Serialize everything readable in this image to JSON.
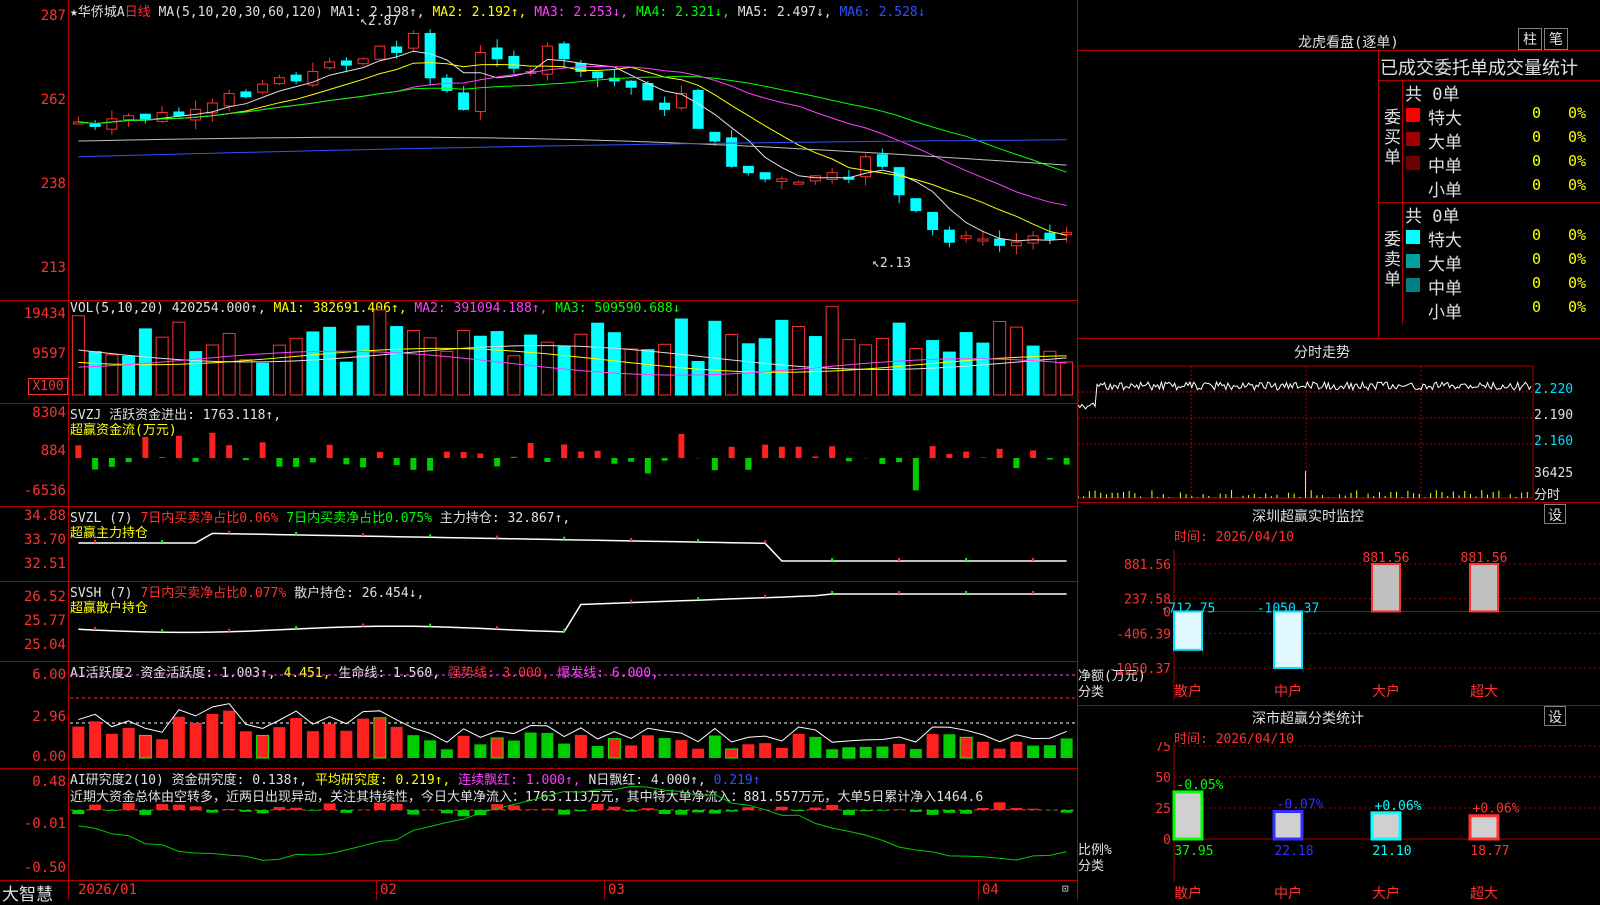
{
  "header": {
    "star": "★",
    "name": "华侨城A",
    "period": "日线",
    "ma_label": "MA(5,10,20,30,60,120)",
    "ma1": "MA1: 2.198↑,",
    "ma2": "MA2: 2.192↑,",
    "ma3": "MA3: 2.253↓,",
    "ma4": "MA4: 2.321↓,",
    "ma5": "MA5: 2.497↓,",
    "ma6": "MA6: 2.528↓",
    "high_mark": "2.87",
    "low_mark": "2.13"
  },
  "price_axis": [
    "287",
    "262",
    "238",
    "213"
  ],
  "vol": {
    "label": "VOL(5,10,20)",
    "value": "420254.000↑,",
    "ma1": "MA1: 382691.406↑,",
    "ma2": "MA2: 391094.188↑,",
    "ma3": "MA3: 509590.688↓",
    "axis": [
      "19434",
      "9597",
      "X100"
    ]
  },
  "svzj": {
    "label": "SVZJ  活跃资金进出: 1763.118↑,",
    "sub": "超赢资金流(万元)",
    "axis": [
      "8304",
      "884",
      "-6536"
    ]
  },
  "svzl": {
    "label1": "SVZL (7)",
    "label2": "7日内买卖净占比0.06%",
    "label3": "7日内买卖净占比0.075%",
    "label4": "主力持仓: 32.867↑,",
    "sub": "超赢主力持仓",
    "axis": [
      "34.88",
      "33.70",
      "32.51"
    ]
  },
  "svsh": {
    "label1": "SVSH (7)",
    "label2": "7日内买卖净占比0.077%",
    "label3": "散户持仓: 26.454↓,",
    "sub": "超赢散户持仓",
    "axis": [
      "26.52",
      "25.77",
      "25.04"
    ]
  },
  "ai_active": {
    "label1": "AI活跃度2 资金活跃度: 1.003↑,",
    "label2": "4.451,",
    "label3": "生命线: 1.560,",
    "label4": "强势线: 3.000,",
    "label5": "爆发线: 6.000,",
    "axis": [
      "6.00",
      "2.96",
      "0.00"
    ]
  },
  "ai_research": {
    "label1": "AI研究度2(10) 资金研究度: 0.138↑,",
    "label2": "平均研究度: 0.219↑,",
    "label3": "连续飘红: 1.000↑,",
    "label4": "N日飘红: 4.000↑,",
    "label5": "0.219↑",
    "comment": "近期大资金总体由空转多，近两日出现异动，关注其持续性，今日大单净流入：1763.113万元，其中特大单净流入：881.557万元，大单5日累计净入1464.6",
    "axis": [
      "0.48",
      "-0.01",
      "-0.50"
    ]
  },
  "bottom_axis": {
    "brand": "大智慧",
    "dates": [
      "2026/01",
      "02",
      "03",
      "04"
    ]
  },
  "right": {
    "lhb_title": "龙虎看盘(逐单)",
    "btn_zhu": "柱",
    "btn_bi": "笔",
    "stat_title": "已成交委托单成交量统计",
    "buy": {
      "side": "委买单",
      "total": "共 0单",
      "rows": [
        {
          "label": "特大",
          "count": "0",
          "pct": "0%",
          "color": "#ff0000"
        },
        {
          "label": "大单",
          "count": "0",
          "pct": "0%",
          "color": "#a00000"
        },
        {
          "label": "中单",
          "count": "0",
          "pct": "0%",
          "color": "#700000"
        },
        {
          "label": "小单",
          "count": "0",
          "pct": "0%",
          "color": "#000000"
        }
      ]
    },
    "sell": {
      "side": "委卖单",
      "total": "共 0单",
      "rows": [
        {
          "label": "特大",
          "count": "0",
          "pct": "0%",
          "color": "#00ffff"
        },
        {
          "label": "大单",
          "count": "0",
          "pct": "0%",
          "color": "#00a0a0"
        },
        {
          "label": "中单",
          "count": "0",
          "pct": "0%",
          "color": "#008080"
        },
        {
          "label": "小单",
          "count": "0",
          "pct": "0%",
          "color": "#000000"
        }
      ]
    },
    "fenshi": {
      "title": "分时走势",
      "axis": [
        "2.220",
        "2.190",
        "2.160",
        "36425",
        "分时"
      ]
    },
    "monitor": {
      "title": "深圳超赢实时监控",
      "btn": "设",
      "time": "时间: 2026/04/10",
      "axis": [
        "881.56",
        "237.58",
        "0",
        "-406.39",
        "-1050.37"
      ],
      "ylabel": "净额(万元)",
      "xlabel": "分类",
      "categories": [
        "散户",
        "中户",
        "大户",
        "超大"
      ],
      "labels": [
        "-712.75",
        "-1050.37",
        "881.56",
        "881.56"
      ]
    },
    "classify": {
      "title": "深市超赢分类统计",
      "btn": "设",
      "time": "时间: 2026/04/10",
      "axis": [
        "75",
        "50",
        "25",
        "0"
      ],
      "ylabel": "比例%",
      "xlabel": "分类",
      "categories": [
        "散户",
        "中户",
        "大户",
        "超大"
      ],
      "top_labels": [
        "-0.05%",
        "-0.07%",
        "+0.06%",
        "+0.06%"
      ],
      "bottom_labels": [
        "37.95",
        "22.18",
        "21.10",
        "18.77"
      ]
    }
  },
  "chart_data": [
    {
      "type": "candlestick",
      "title": "华侨城A 日线",
      "ylim": [
        2.1,
        2.9
      ],
      "high": 2.87,
      "low": 2.13
    },
    {
      "type": "bar",
      "title": "深圳超赢实时监控",
      "categories": [
        "散户",
        "中户",
        "大户",
        "超大"
      ],
      "values": [
        -712.75,
        -1050.37,
        881.56,
        881.56
      ],
      "ylabel": "净额(万元)",
      "ylim": [
        -1050.37,
        881.56
      ]
    },
    {
      "type": "bar",
      "title": "深市超赢分类统计",
      "categories": [
        "散户",
        "中户",
        "大户",
        "超大"
      ],
      "values": [
        37.95,
        22.18,
        21.1,
        18.77
      ],
      "ylabel": "比例%",
      "ylim": [
        0,
        75
      ]
    }
  ]
}
